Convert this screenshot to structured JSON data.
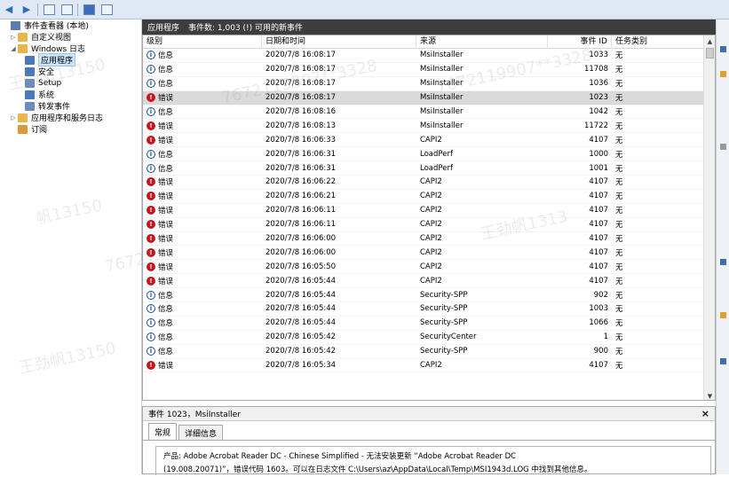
{
  "toolbar": {
    "buttons": [
      "back-arrow-icon",
      "forward-arrow-icon",
      "properties-icon",
      "console-icon",
      "help-icon",
      "window-icon"
    ]
  },
  "tree": {
    "items": [
      {
        "label": "事件查看器 (本地)",
        "level": 0,
        "arrow": "",
        "icon_color": "#5a7bb5"
      },
      {
        "label": "自定义视图",
        "level": 1,
        "arrow": "▷",
        "icon_color": "#e8b64b"
      },
      {
        "label": "Windows 日志",
        "level": 1,
        "arrow": "◢",
        "icon_color": "#e8b64b"
      },
      {
        "label": "应用程序",
        "level": 2,
        "arrow": "",
        "icon_color": "#4a78b8",
        "selected": true
      },
      {
        "label": "安全",
        "level": 2,
        "arrow": "",
        "icon_color": "#4a78b8"
      },
      {
        "label": "Setup",
        "level": 2,
        "arrow": "",
        "icon_color": "#6a8cc0"
      },
      {
        "label": "系统",
        "level": 2,
        "arrow": "",
        "icon_color": "#4a78b8"
      },
      {
        "label": "转发事件",
        "level": 2,
        "arrow": "",
        "icon_color": "#6a8cc0"
      },
      {
        "label": "应用程序和服务日志",
        "level": 1,
        "arrow": "▷",
        "icon_color": "#e8b64b"
      },
      {
        "label": "订阅",
        "level": 1,
        "arrow": "",
        "icon_color": "#d99a3a"
      }
    ]
  },
  "pane": {
    "title": "应用程序",
    "count": "事件数: 1,003 (!) 可用的新事件"
  },
  "table": {
    "headers": [
      "级别",
      "日期和时间",
      "来源",
      "事件 ID",
      "任务类别"
    ],
    "rows": [
      {
        "level": "信息",
        "type": "info",
        "date": "2020/7/8 16:08:17",
        "source": "MsiInstaller",
        "id": "1033",
        "task": "无"
      },
      {
        "level": "信息",
        "type": "info",
        "date": "2020/7/8 16:08:17",
        "source": "MsiInstaller",
        "id": "11708",
        "task": "无"
      },
      {
        "level": "信息",
        "type": "info",
        "date": "2020/7/8 16:08:17",
        "source": "MsiInstaller",
        "id": "1036",
        "task": "无"
      },
      {
        "level": "错误",
        "type": "err",
        "date": "2020/7/8 16:08:17",
        "source": "MsiInstaller",
        "id": "1023",
        "task": "无",
        "selected": true
      },
      {
        "level": "信息",
        "type": "info",
        "date": "2020/7/8 16:08:16",
        "source": "MsiInstaller",
        "id": "1042",
        "task": "无"
      },
      {
        "level": "错误",
        "type": "err",
        "date": "2020/7/8 16:08:13",
        "source": "MsiInstaller",
        "id": "11722",
        "task": "无"
      },
      {
        "level": "错误",
        "type": "err",
        "date": "2020/7/8 16:06:33",
        "source": "CAPI2",
        "id": "4107",
        "task": "无"
      },
      {
        "level": "信息",
        "type": "info",
        "date": "2020/7/8 16:06:31",
        "source": "LoadPerf",
        "id": "1000",
        "task": "无"
      },
      {
        "level": "信息",
        "type": "info",
        "date": "2020/7/8 16:06:31",
        "source": "LoadPerf",
        "id": "1001",
        "task": "无"
      },
      {
        "level": "错误",
        "type": "err",
        "date": "2020/7/8 16:06:22",
        "source": "CAPI2",
        "id": "4107",
        "task": "无"
      },
      {
        "level": "错误",
        "type": "err",
        "date": "2020/7/8 16:06:21",
        "source": "CAPI2",
        "id": "4107",
        "task": "无"
      },
      {
        "level": "错误",
        "type": "err",
        "date": "2020/7/8 16:06:11",
        "source": "CAPI2",
        "id": "4107",
        "task": "无"
      },
      {
        "level": "错误",
        "type": "err",
        "date": "2020/7/8 16:06:11",
        "source": "CAPI2",
        "id": "4107",
        "task": "无"
      },
      {
        "level": "错误",
        "type": "err",
        "date": "2020/7/8 16:06:00",
        "source": "CAPI2",
        "id": "4107",
        "task": "无"
      },
      {
        "level": "错误",
        "type": "err",
        "date": "2020/7/8 16:06:00",
        "source": "CAPI2",
        "id": "4107",
        "task": "无"
      },
      {
        "level": "错误",
        "type": "err",
        "date": "2020/7/8 16:05:50",
        "source": "CAPI2",
        "id": "4107",
        "task": "无"
      },
      {
        "level": "错误",
        "type": "err",
        "date": "2020/7/8 16:05:44",
        "source": "CAPI2",
        "id": "4107",
        "task": "无"
      },
      {
        "level": "信息",
        "type": "info",
        "date": "2020/7/8 16:05:44",
        "source": "Security-SPP",
        "id": "902",
        "task": "无"
      },
      {
        "level": "信息",
        "type": "info",
        "date": "2020/7/8 16:05:44",
        "source": "Security-SPP",
        "id": "1003",
        "task": "无"
      },
      {
        "level": "信息",
        "type": "info",
        "date": "2020/7/8 16:05:44",
        "source": "Security-SPP",
        "id": "1066",
        "task": "无"
      },
      {
        "level": "信息",
        "type": "info",
        "date": "2020/7/8 16:05:42",
        "source": "SecurityCenter",
        "id": "1",
        "task": "无"
      },
      {
        "level": "信息",
        "type": "info",
        "date": "2020/7/8 16:05:42",
        "source": "Security-SPP",
        "id": "900",
        "task": "无"
      },
      {
        "level": "错误",
        "type": "err",
        "date": "2020/7/8 16:05:34",
        "source": "CAPI2",
        "id": "4107",
        "task": "无"
      }
    ]
  },
  "detail": {
    "title": "事件 1023，MsiInstaller",
    "close": "×",
    "tabs": [
      "常规",
      "详细信息"
    ],
    "line1": "产品: Adobe Acrobat Reader DC - Chinese Simplified - 无法安装更新 “Adobe Acrobat Reader DC",
    "line2": "(19.008.20071)”，错误代码 1603。可以在日志文件 C:\\Users\\az\\AppData\\Local\\Temp\\MSI1943d.LOG 中找到其他信息。"
  },
  "watermarks": [
    "王劲帆13150",
    "7672119907**3328",
    "帆13150",
    "76721",
    "王劲帆1313",
    "7672119907**3328",
    "王劲帆13150"
  ],
  "colors": {
    "error": "#c4161c",
    "info": "#1f4e9a",
    "header_dark": "#3d3d3d",
    "selection": "#dadada"
  }
}
